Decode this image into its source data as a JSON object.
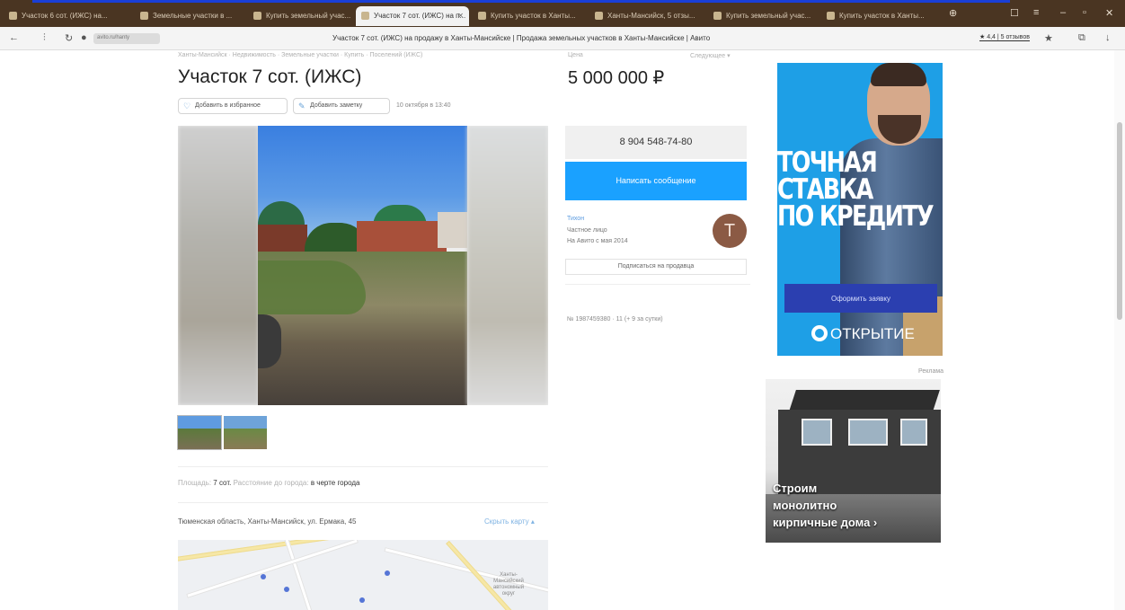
{
  "browser": {
    "tabs": [
      {
        "label": "Участок 6 сот. (ИЖС) на...",
        "active": false
      },
      {
        "label": "Земельные участки в ...",
        "active": false
      },
      {
        "label": "Купить земельный учас...",
        "active": false
      },
      {
        "label": "Участок 7 сот. (ИЖС) на п...",
        "active": true
      },
      {
        "label": "Купить участок в Ханты...",
        "active": false
      },
      {
        "label": "Ханты-Мансийск, 5 отзы...",
        "active": false
      },
      {
        "label": "Купить земельный учас...",
        "active": false
      },
      {
        "label": "Купить участок в Ханты...",
        "active": false
      }
    ],
    "url_chip": "avito.ru/hanty",
    "page_title": "Участок 7 сот. (ИЖС) на продажу в Ханты-Мансийске | Продажа земельных участков в Ханты-Мансийске | Авито",
    "reviews_link": "★ 4,4 | 5 отзывов"
  },
  "listing": {
    "breadcrumb": "Ханты-Мансийск · Недвижимость · Земельные участки · Купить · Поселений (ИЖС)",
    "title": "Участок 7 сот. (ИЖС)",
    "price_label": "Цена",
    "currency_select": "Следующее ▾",
    "price": "5 000 000 ₽",
    "actions": {
      "favorite": "Добавить в избранное",
      "note": "Добавить заметку"
    },
    "date": "10 октября в 13:40",
    "params": {
      "area_label": "Площадь:",
      "area_value": "7 сот.",
      "distance_label": "Расстояние до города:",
      "distance_value": "в черте города"
    },
    "address": "Тюменская область, Ханты-Мансийск, ул. Ермака, 45",
    "map_link": "Скрыть карту ▴",
    "map_poi": "Ханты-Мансийский автономный округ"
  },
  "contact": {
    "phone": "8 904 548-74-80",
    "message_button": "Написать сообщение",
    "seller_name": "Тихон",
    "seller_type": "Частное лицо",
    "seller_since": "На Авито с мая 2014",
    "avatar_letter": "Т",
    "subscribe_button": "Подписаться на продавца",
    "ad_number": "№ 1987459380 · 11 (+ 9 за сутки)"
  },
  "ads": {
    "banner1": {
      "headline_lines": [
        "ТОЧНАЯ",
        "СТАВКА",
        "ПО КРЕДИТУ"
      ],
      "cta": "Оформить заявку",
      "brand": "ОТКРЫТИЕ"
    },
    "ad_mark": "Реклама",
    "banner2": {
      "text_lines": [
        "Строим",
        "монолитно",
        "кирпичные дома ›"
      ]
    }
  },
  "colors": {
    "accent_blue": "#1aa1ff",
    "ad_blue": "#1e9fe6",
    "ad_cta": "#2b3fb0",
    "avatar": "#8b5a44"
  }
}
